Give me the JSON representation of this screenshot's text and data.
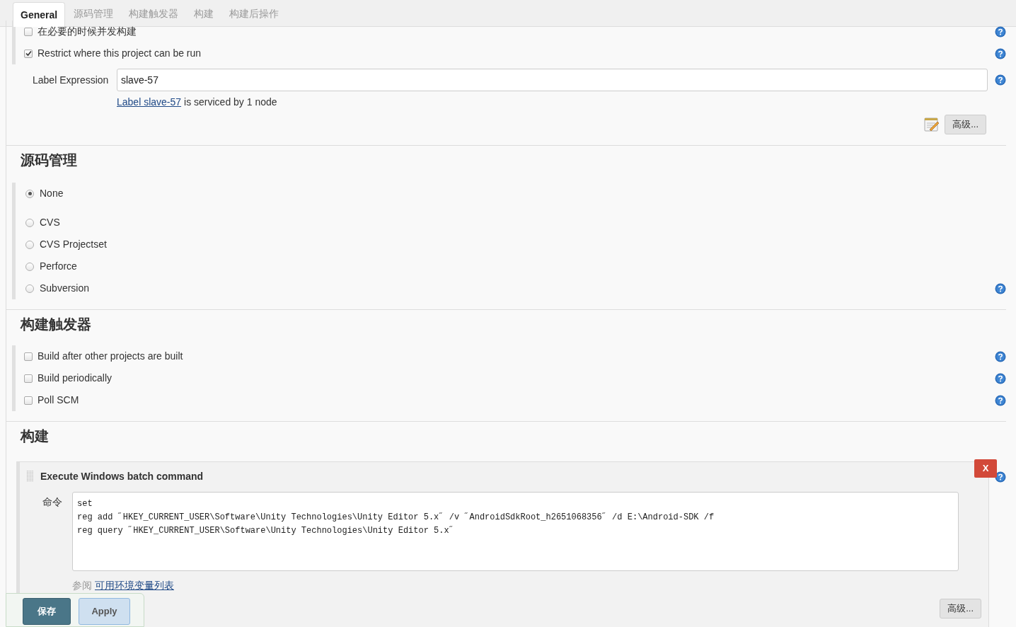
{
  "tabs": [
    {
      "label": "General",
      "selected": true
    },
    {
      "label": "源码管理",
      "selected": false
    },
    {
      "label": "构建触发器",
      "selected": false
    },
    {
      "label": "构建",
      "selected": false
    },
    {
      "label": "构建后操作",
      "selected": false
    }
  ],
  "general": {
    "options": [
      {
        "label": "在必要的时候并发构建",
        "checked": false,
        "help": true
      },
      {
        "label": "Restrict where this project can be run",
        "checked": true,
        "help": true
      }
    ],
    "label_expression": {
      "label": "Label Expression",
      "value": "slave-57"
    },
    "label_note": {
      "link": "Label slave-57",
      "text": "is serviced by 1 node"
    },
    "advanced_button": "高级..."
  },
  "scm": {
    "title": "源码管理",
    "options": [
      {
        "label": "None",
        "selected": true,
        "help": false
      },
      {
        "label": "CVS",
        "selected": false,
        "help": false
      },
      {
        "label": "CVS Projectset",
        "selected": false,
        "help": false
      },
      {
        "label": "Perforce",
        "selected": false,
        "help": false
      },
      {
        "label": "Subversion",
        "selected": false,
        "help": true
      }
    ]
  },
  "triggers": {
    "title": "构建触发器",
    "options": [
      {
        "label": "Build after other projects are built",
        "checked": false,
        "help": true
      },
      {
        "label": "Build periodically",
        "checked": false,
        "help": true
      },
      {
        "label": "Poll SCM",
        "checked": false,
        "help": true
      }
    ]
  },
  "build": {
    "title": "构建",
    "step": {
      "title": "Execute Windows batch command",
      "delete_label": "X",
      "field_label": "命令",
      "lines": [
        "set",
        "reg add ˝HKEY_CURRENT_USER\\Software\\Unity Technologies\\Unity Editor 5.x˝ /v ˝AndroidSdkRoot_h2651068356˝ /d E:\\Android-SDK /f",
        "reg query ˝HKEY_CURRENT_USER\\Software\\Unity Technologies\\Unity Editor 5.x˝"
      ],
      "hint": {
        "text": "参阅",
        "link": "可用环境变量列表"
      },
      "advanced_button": "高级..."
    }
  },
  "footer": {
    "buttons": [
      {
        "label": "保存",
        "kind": "primary"
      },
      {
        "label": "Apply",
        "kind": "secondary"
      }
    ]
  }
}
